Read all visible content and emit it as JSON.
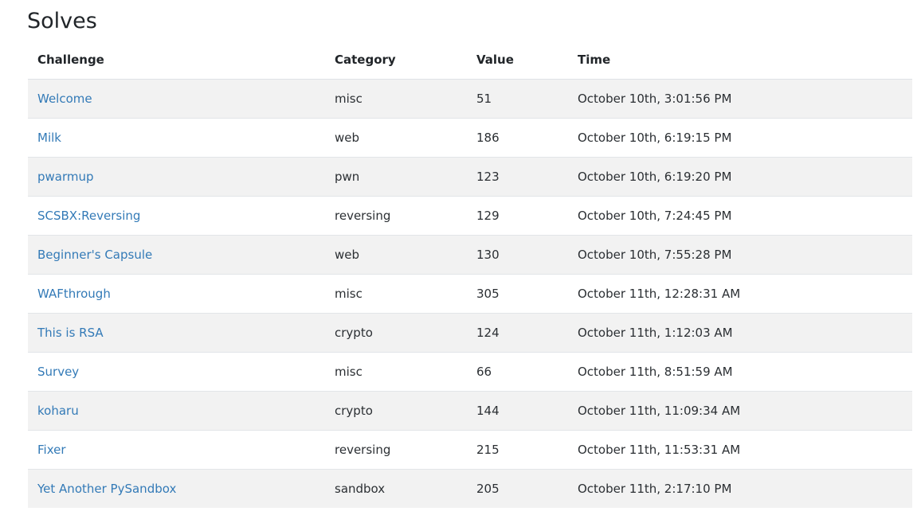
{
  "page": {
    "title": "Solves"
  },
  "table": {
    "headers": {
      "challenge": "Challenge",
      "category": "Category",
      "value": "Value",
      "time": "Time"
    },
    "rows": [
      {
        "challenge": "Welcome",
        "category": "misc",
        "value": "51",
        "time": "October 10th, 3:01:56 PM"
      },
      {
        "challenge": "Milk",
        "category": "web",
        "value": "186",
        "time": "October 10th, 6:19:15 PM"
      },
      {
        "challenge": "pwarmup",
        "category": "pwn",
        "value": "123",
        "time": "October 10th, 6:19:20 PM"
      },
      {
        "challenge": "SCSBX:Reversing",
        "category": "reversing",
        "value": "129",
        "time": "October 10th, 7:24:45 PM"
      },
      {
        "challenge": "Beginner's Capsule",
        "category": "web",
        "value": "130",
        "time": "October 10th, 7:55:28 PM"
      },
      {
        "challenge": "WAFthrough",
        "category": "misc",
        "value": "305",
        "time": "October 11th, 12:28:31 AM"
      },
      {
        "challenge": "This is RSA",
        "category": "crypto",
        "value": "124",
        "time": "October 11th, 1:12:03 AM"
      },
      {
        "challenge": "Survey",
        "category": "misc",
        "value": "66",
        "time": "October 11th, 8:51:59 AM"
      },
      {
        "challenge": "koharu",
        "category": "crypto",
        "value": "144",
        "time": "October 11th, 11:09:34 AM"
      },
      {
        "challenge": "Fixer",
        "category": "reversing",
        "value": "215",
        "time": "October 11th, 11:53:31 AM"
      },
      {
        "challenge": "Yet Another PySandbox",
        "category": "sandbox",
        "value": "205",
        "time": "October 11th, 2:17:10 PM"
      }
    ]
  },
  "colors": {
    "link": "#337ab7",
    "stripe": "#f2f2f2",
    "text": "#212529"
  }
}
